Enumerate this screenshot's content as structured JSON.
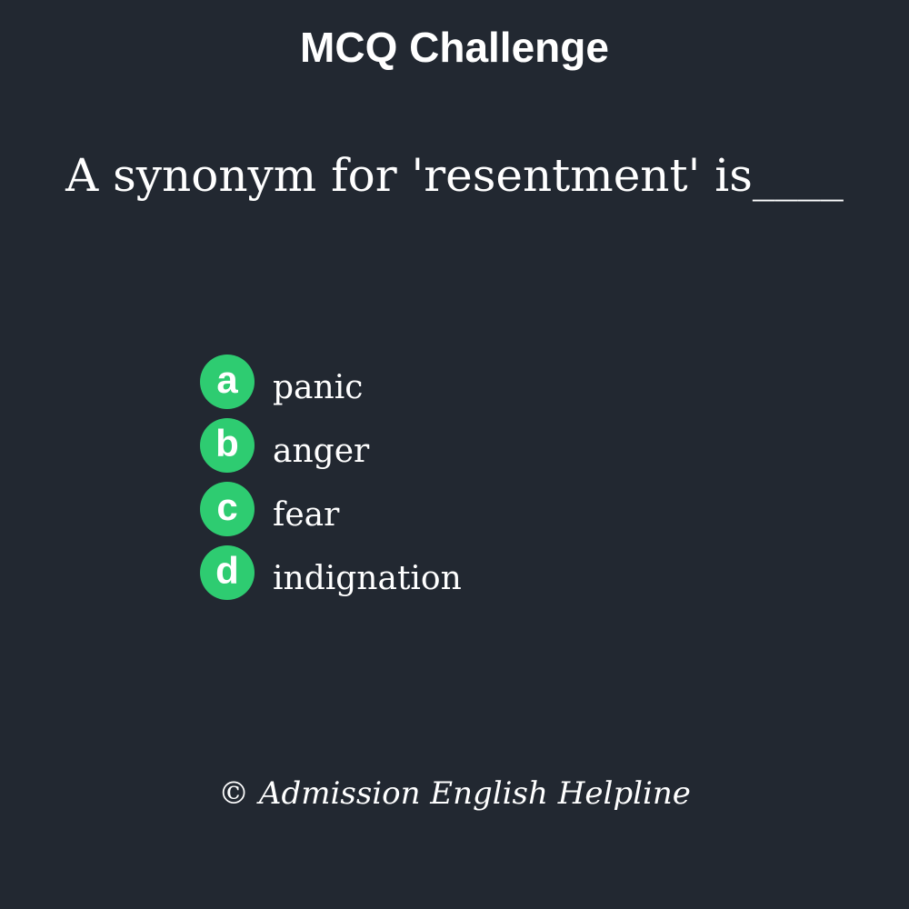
{
  "header": {
    "title": "MCQ Challenge"
  },
  "question": {
    "text": "A synonym for 'resentment' is____"
  },
  "options": [
    {
      "letter": "a",
      "text": "panic"
    },
    {
      "letter": "b",
      "text": "anger"
    },
    {
      "letter": "c",
      "text": "fear"
    },
    {
      "letter": "d",
      "text": "indignation"
    }
  ],
  "footer": {
    "copyright": "© Admission English Helpline"
  },
  "colors": {
    "background": "#222831",
    "badge": "#2ecc71",
    "text": "#ffffff"
  }
}
